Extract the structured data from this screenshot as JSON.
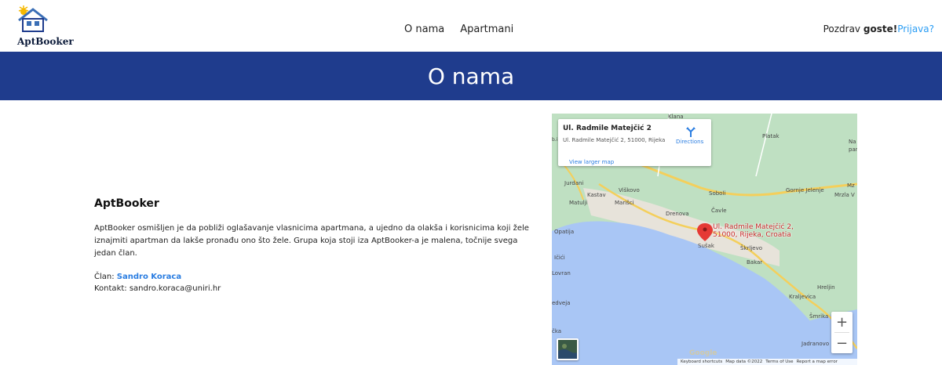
{
  "brand": {
    "name": "AptBooker"
  },
  "nav": {
    "items": [
      {
        "label": "O nama"
      },
      {
        "label": "Apartmani"
      }
    ]
  },
  "user": {
    "greeting": "Pozdrav",
    "name": "goste!",
    "login": "Prijava?"
  },
  "banner": {
    "title": "O nama"
  },
  "about": {
    "heading": "AptBooker",
    "description": "AptBooker osmišljen je da pobliži oglašavanje vlasnicima apartmana, a ujedno da olakša i korisnicima koji žele iznajmiti apartman da lakše pronađu ono što žele. Grupa koja stoji iza AptBooker-a je malena, točnije svega jedan član.",
    "member_label": "Član:",
    "member_name": "Sandro Koraca",
    "contact_label": "Kontakt:",
    "contact_email": "sandro.koraca@uniri.hr"
  },
  "map": {
    "place_title": "Ul. Radmile Matejčić 2",
    "place_address": "Ul. Radmile Matejčić 2, 51000, Rijeka",
    "directions_label": "Directions",
    "view_larger": "View larger map",
    "pin_label_line1": "Ul. Radmile Matejčić 2,",
    "pin_label_line2": "51000, Rijeka, Croatia",
    "zoom_in": "+",
    "zoom_out": "−",
    "google": "Google",
    "footer": [
      "Keyboard shortcuts",
      "Map data ©2022",
      "Terms of Use",
      "Report a map error"
    ],
    "places": {
      "klana": "Klana",
      "platak": "Platak",
      "jurdani": "Jurdani",
      "kastav": "Kastav",
      "viskovo": "Viškovo",
      "soboli": "Soboli",
      "gornje_jelenje": "Gornje Jelenje",
      "matulji": "Matulji",
      "marisci": "Marišci",
      "cavle": "Čavle",
      "drenova": "Drenova",
      "opatija": "Opatija",
      "susak": "Sušak",
      "skrljevo": "Škrljevo",
      "bakar": "Bakar",
      "lovran": "Lovran",
      "icici": "Ičići",
      "hreljin": "Hreljin",
      "kraljevica": "Kraljevica",
      "smrika": "Šmrika",
      "jadranovo": "Jadranovo",
      "medveja": "edveja",
      "mrzla": "Mrzla V",
      "na": "Na",
      "par": "par",
      "ica": "čka",
      "bi": "b.i",
      "mz": "Mz"
    }
  }
}
